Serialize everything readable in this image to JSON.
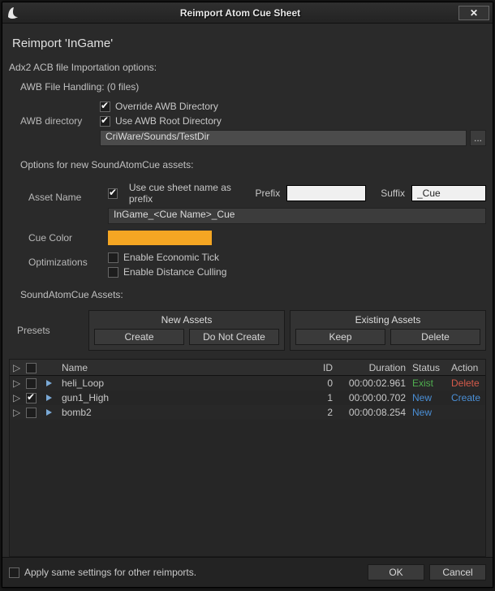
{
  "window": {
    "title": "Reimport Atom Cue Sheet",
    "close": "✕"
  },
  "heading": "Reimport 'InGame'",
  "section_import": "Adx2 ACB file Importation options:",
  "awb": {
    "handling_label": "AWB File Handling: (0 files)",
    "dir_label": "AWB directory",
    "override_label": "Override AWB Directory",
    "useroot_label": "Use AWB Root Directory",
    "path": "CriWare/Sounds/TestDir",
    "ellipsis": "..."
  },
  "section_newcue": "Options for new SoundAtomCue assets:",
  "assetname": {
    "row_label": "Asset Name",
    "prefix_cb_label": "Use cue sheet name as prefix",
    "prefix_label": "Prefix",
    "prefix_value": "",
    "suffix_label": "Suffix",
    "suffix_value": "_Cue",
    "preview": "InGame_<Cue Name>_Cue"
  },
  "cuecolor": {
    "row_label": "Cue Color",
    "hex": "#f5a623"
  },
  "opt": {
    "row_label": "Optimizations",
    "eco_label": "Enable Economic Tick",
    "cull_label": "Enable Distance Culling"
  },
  "section_assets": "SoundAtomCue Assets:",
  "presets": {
    "row_label": "Presets",
    "new_title": "New Assets",
    "new_create": "Create",
    "new_skip": "Do Not Create",
    "exist_title": "Existing Assets",
    "exist_keep": "Keep",
    "exist_delete": "Delete"
  },
  "columns": {
    "name": "Name",
    "id": "ID",
    "duration": "Duration",
    "status": "Status",
    "action": "Action"
  },
  "rows": [
    {
      "checked": false,
      "name": "heli_Loop",
      "id": "0",
      "dur": "00:00:02.961",
      "status": "Exist",
      "action": "Delete"
    },
    {
      "checked": true,
      "name": "gun1_High",
      "id": "1",
      "dur": "00:00:00.702",
      "status": "New",
      "action": "Create"
    },
    {
      "checked": false,
      "name": "bomb2",
      "id": "2",
      "dur": "00:00:08.254",
      "status": "New",
      "action": ""
    }
  ],
  "footer": {
    "apply_label": "Apply same settings for other reimports.",
    "ok": "OK",
    "cancel": "Cancel"
  }
}
